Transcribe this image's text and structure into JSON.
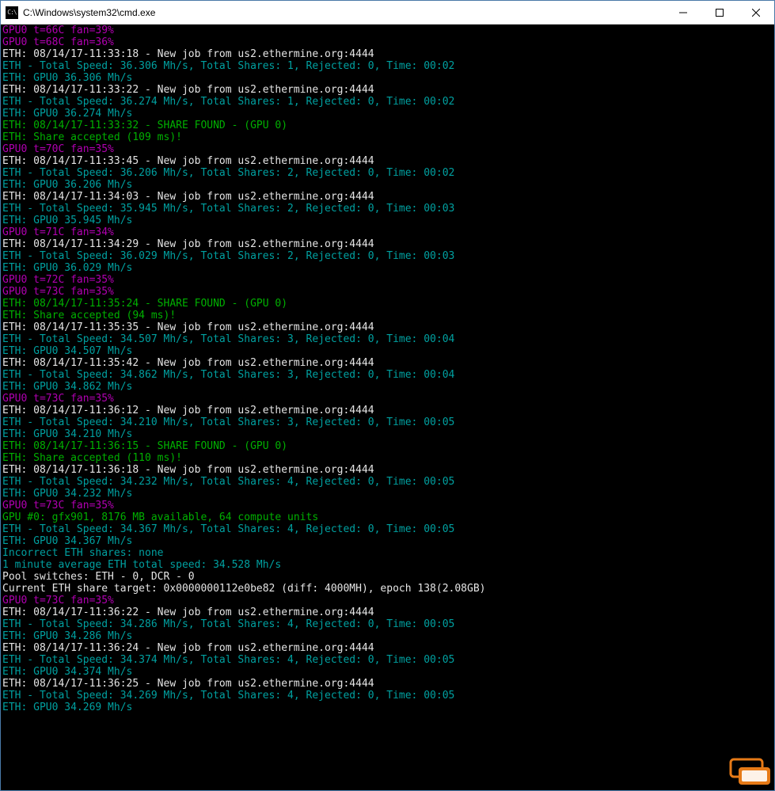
{
  "window": {
    "icon_text": "C:\\",
    "title": "C:\\Windows\\system32\\cmd.exe"
  },
  "controls": {
    "min_tip": "Minimize",
    "max_tip": "Maximize",
    "close_tip": "Close"
  },
  "lines": [
    {
      "cls": "c-magenta",
      "text": "GPU0 t=66C fan=39%"
    },
    {
      "cls": "c-magenta",
      "text": "GPU0 t=68C fan=36%"
    },
    {
      "cls": "c-white",
      "text": "ETH: 08/14/17-11:33:18 - New job from us2.ethermine.org:4444"
    },
    {
      "cls": "c-teal",
      "text": "ETH - Total Speed: 36.306 Mh/s, Total Shares: 1, Rejected: 0, Time: 00:02"
    },
    {
      "cls": "c-teal",
      "text": "ETH: GPU0 36.306 Mh/s"
    },
    {
      "cls": "c-white",
      "text": "ETH: 08/14/17-11:33:22 - New job from us2.ethermine.org:4444"
    },
    {
      "cls": "c-teal",
      "text": "ETH - Total Speed: 36.274 Mh/s, Total Shares: 1, Rejected: 0, Time: 00:02"
    },
    {
      "cls": "c-teal",
      "text": "ETH: GPU0 36.274 Mh/s"
    },
    {
      "cls": "c-green",
      "text": "ETH: 08/14/17-11:33:32 - SHARE FOUND - (GPU 0)"
    },
    {
      "cls": "c-green",
      "text": "ETH: Share accepted (109 ms)!"
    },
    {
      "cls": "c-magenta",
      "text": "GPU0 t=70C fan=35%"
    },
    {
      "cls": "c-white",
      "text": "ETH: 08/14/17-11:33:45 - New job from us2.ethermine.org:4444"
    },
    {
      "cls": "c-teal",
      "text": "ETH - Total Speed: 36.206 Mh/s, Total Shares: 2, Rejected: 0, Time: 00:02"
    },
    {
      "cls": "c-teal",
      "text": "ETH: GPU0 36.206 Mh/s"
    },
    {
      "cls": "c-white",
      "text": "ETH: 08/14/17-11:34:03 - New job from us2.ethermine.org:4444"
    },
    {
      "cls": "c-teal",
      "text": "ETH - Total Speed: 35.945 Mh/s, Total Shares: 2, Rejected: 0, Time: 00:03"
    },
    {
      "cls": "c-teal",
      "text": "ETH: GPU0 35.945 Mh/s"
    },
    {
      "cls": "c-magenta",
      "text": "GPU0 t=71C fan=34%"
    },
    {
      "cls": "c-white",
      "text": "ETH: 08/14/17-11:34:29 - New job from us2.ethermine.org:4444"
    },
    {
      "cls": "c-teal",
      "text": "ETH - Total Speed: 36.029 Mh/s, Total Shares: 2, Rejected: 0, Time: 00:03"
    },
    {
      "cls": "c-teal",
      "text": "ETH: GPU0 36.029 Mh/s"
    },
    {
      "cls": "c-magenta",
      "text": "GPU0 t=72C fan=35%"
    },
    {
      "cls": "c-magenta",
      "text": "GPU0 t=73C fan=35%"
    },
    {
      "cls": "c-green",
      "text": "ETH: 08/14/17-11:35:24 - SHARE FOUND - (GPU 0)"
    },
    {
      "cls": "c-green",
      "text": "ETH: Share accepted (94 ms)!"
    },
    {
      "cls": "c-white",
      "text": "ETH: 08/14/17-11:35:35 - New job from us2.ethermine.org:4444"
    },
    {
      "cls": "c-teal",
      "text": "ETH - Total Speed: 34.507 Mh/s, Total Shares: 3, Rejected: 0, Time: 00:04"
    },
    {
      "cls": "c-teal",
      "text": "ETH: GPU0 34.507 Mh/s"
    },
    {
      "cls": "c-white",
      "text": "ETH: 08/14/17-11:35:42 - New job from us2.ethermine.org:4444"
    },
    {
      "cls": "c-teal",
      "text": "ETH - Total Speed: 34.862 Mh/s, Total Shares: 3, Rejected: 0, Time: 00:04"
    },
    {
      "cls": "c-teal",
      "text": "ETH: GPU0 34.862 Mh/s"
    },
    {
      "cls": "c-magenta",
      "text": "GPU0 t=73C fan=35%"
    },
    {
      "cls": "c-white",
      "text": "ETH: 08/14/17-11:36:12 - New job from us2.ethermine.org:4444"
    },
    {
      "cls": "c-teal",
      "text": "ETH - Total Speed: 34.210 Mh/s, Total Shares: 3, Rejected: 0, Time: 00:05"
    },
    {
      "cls": "c-teal",
      "text": "ETH: GPU0 34.210 Mh/s"
    },
    {
      "cls": "c-green",
      "text": "ETH: 08/14/17-11:36:15 - SHARE FOUND - (GPU 0)"
    },
    {
      "cls": "c-green",
      "text": "ETH: Share accepted (110 ms)!"
    },
    {
      "cls": "c-white",
      "text": "ETH: 08/14/17-11:36:18 - New job from us2.ethermine.org:4444"
    },
    {
      "cls": "c-teal",
      "text": "ETH - Total Speed: 34.232 Mh/s, Total Shares: 4, Rejected: 0, Time: 00:05"
    },
    {
      "cls": "c-teal",
      "text": "ETH: GPU0 34.232 Mh/s"
    },
    {
      "cls": "c-magenta",
      "text": "GPU0 t=73C fan=35%"
    },
    {
      "cls": "",
      "text": ""
    },
    {
      "cls": "c-green",
      "text": "GPU #0: gfx901, 8176 MB available, 64 compute units"
    },
    {
      "cls": "c-teal",
      "text": "ETH - Total Speed: 34.367 Mh/s, Total Shares: 4, Rejected: 0, Time: 00:05"
    },
    {
      "cls": "c-teal",
      "text": "ETH: GPU0 34.367 Mh/s"
    },
    {
      "cls": "c-teal",
      "text": "Incorrect ETH shares: none"
    },
    {
      "cls": "c-teal",
      "text": "1 minute average ETH total speed: 34.528 Mh/s"
    },
    {
      "cls": "c-white",
      "text": "Pool switches: ETH - 0, DCR - 0"
    },
    {
      "cls": "c-white",
      "text": "Current ETH share target: 0x0000000112e0be82 (diff: 4000MH), epoch 138(2.08GB)"
    },
    {
      "cls": "c-magenta",
      "text": "GPU0 t=73C fan=35%"
    },
    {
      "cls": "",
      "text": ""
    },
    {
      "cls": "c-white",
      "text": "ETH: 08/14/17-11:36:22 - New job from us2.ethermine.org:4444"
    },
    {
      "cls": "c-teal",
      "text": "ETH - Total Speed: 34.286 Mh/s, Total Shares: 4, Rejected: 0, Time: 00:05"
    },
    {
      "cls": "c-teal",
      "text": "ETH: GPU0 34.286 Mh/s"
    },
    {
      "cls": "c-white",
      "text": "ETH: 08/14/17-11:36:24 - New job from us2.ethermine.org:4444"
    },
    {
      "cls": "c-teal",
      "text": "ETH - Total Speed: 34.374 Mh/s, Total Shares: 4, Rejected: 0, Time: 00:05"
    },
    {
      "cls": "c-teal",
      "text": "ETH: GPU0 34.374 Mh/s"
    },
    {
      "cls": "c-white",
      "text": "ETH: 08/14/17-11:36:25 - New job from us2.ethermine.org:4444"
    },
    {
      "cls": "c-teal",
      "text": "ETH - Total Speed: 34.269 Mh/s, Total Shares: 4, Rejected: 0, Time: 00:05"
    },
    {
      "cls": "c-teal",
      "text": "ETH: GPU0 34.269 Mh/s"
    }
  ]
}
